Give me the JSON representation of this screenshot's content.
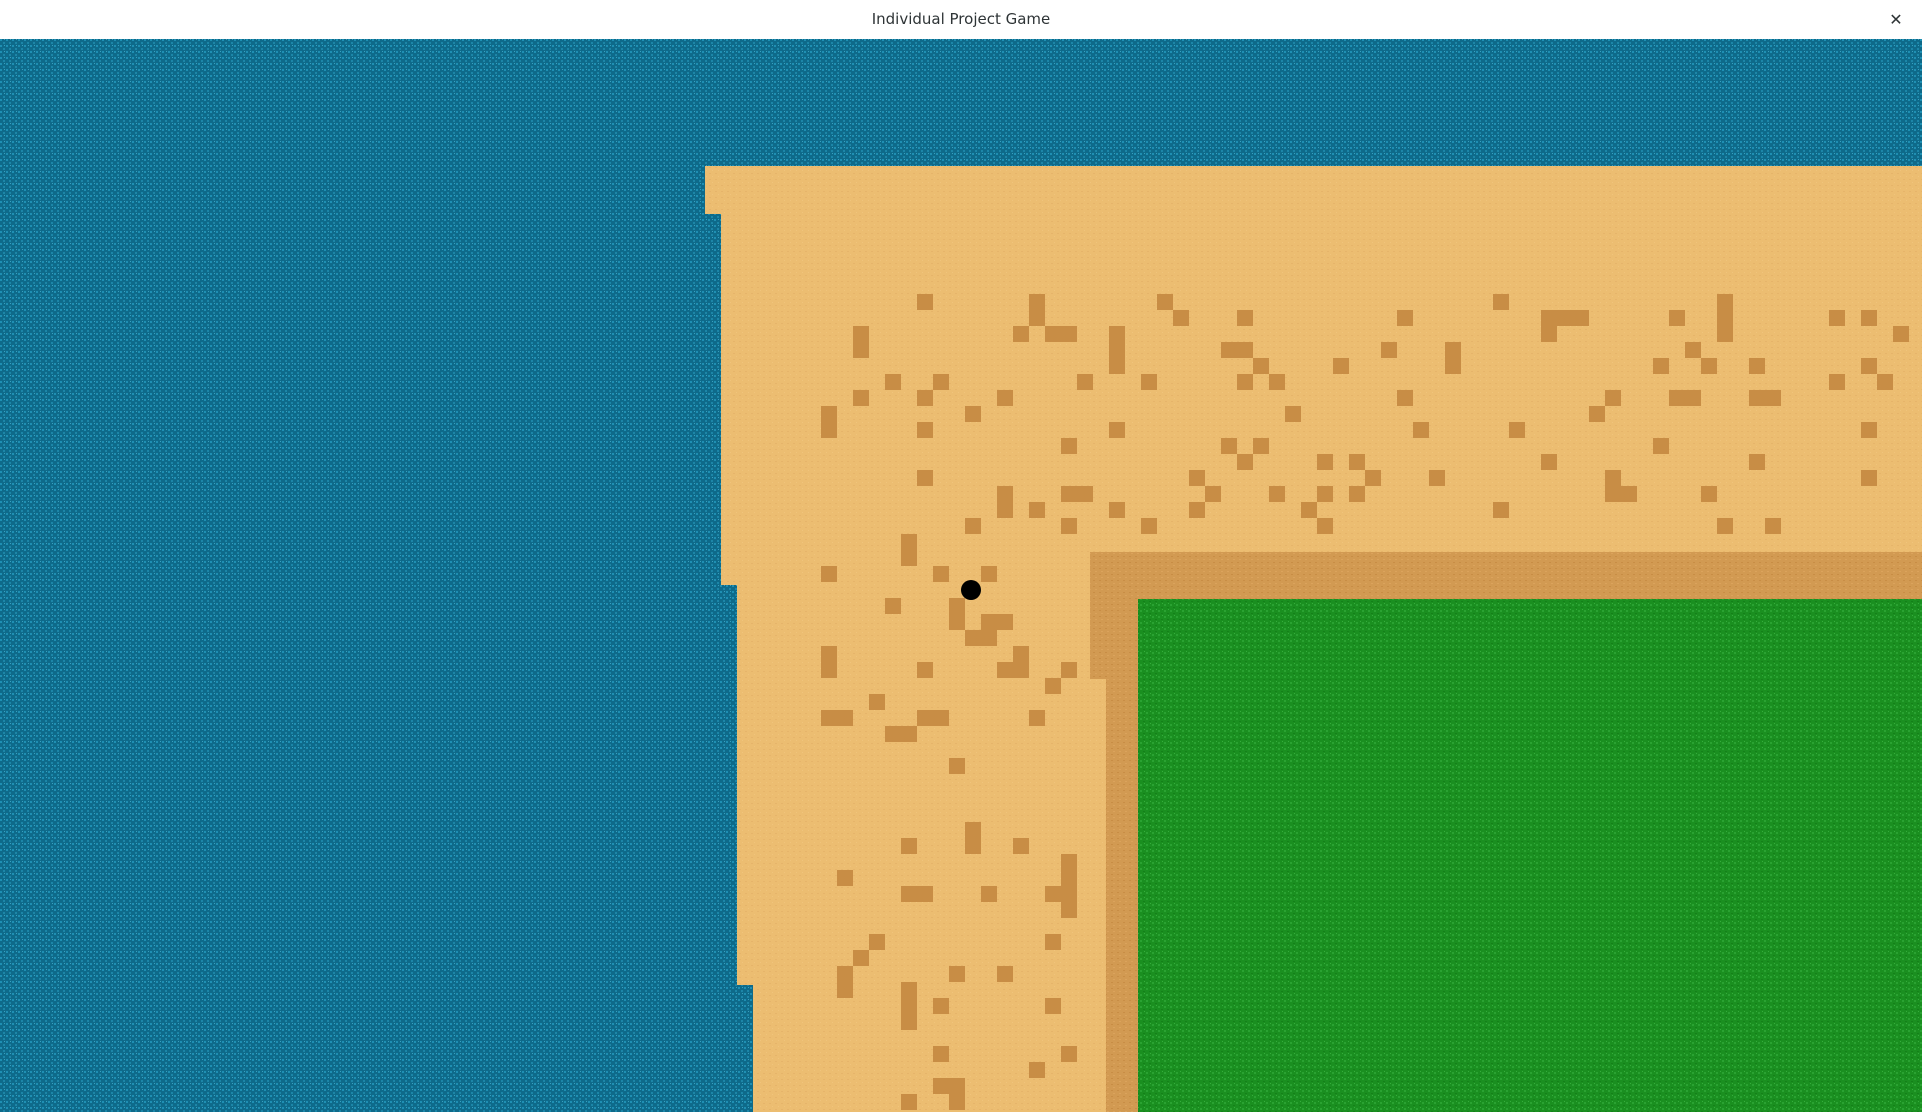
{
  "window": {
    "title": "Individual Project Game",
    "close_icon": "close-icon",
    "close_glyph": "✕"
  },
  "game": {
    "terrain_types": [
      "water",
      "sand",
      "dirt",
      "grass"
    ],
    "entities": [
      {
        "type": "player",
        "icon": "player-marker-icon"
      }
    ]
  },
  "colors": {
    "water": "#0e6a8a",
    "water_speckle": "#1f8fb3",
    "sand": "#ecbd71",
    "dirt": "#d29a52",
    "dirt_dark": "#c88d45",
    "grass": "#1a8f20",
    "grass_speckle": "#2aa232",
    "player": "#000000"
  }
}
